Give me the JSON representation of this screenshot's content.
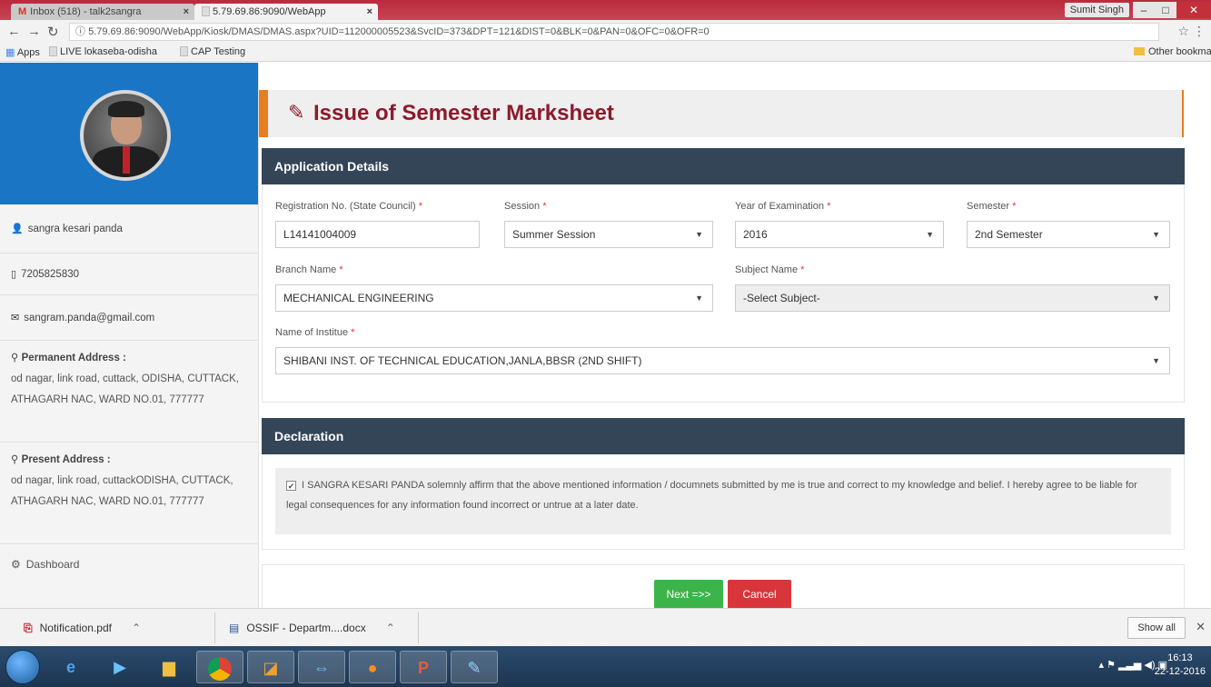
{
  "browser": {
    "tabs": [
      {
        "label": "Inbox (518) - talk2sangra",
        "icon": "gmail-icon"
      },
      {
        "label": "5.79.69.86:9090/WebApp",
        "icon": "page-icon"
      }
    ],
    "user": "Sumit Singh",
    "url": "5.79.69.86:9090/WebApp/Kiosk/DMAS/DMAS.aspx?UID=112000005523&SvcID=373&DPT=121&DIST=0&BLK=0&PAN=0&OFC=0&OFR=0",
    "bookmarks": [
      "Apps",
      "LIVE lokaseba-odisha",
      "CAP Testing"
    ],
    "other_bookmarks": "Other bookmarks"
  },
  "sidebar": {
    "name": "sangra kesari panda",
    "phone": "7205825830",
    "email": "sangram.panda@gmail.com",
    "permanent_title": "Permanent Address :",
    "permanent_address": "od nagar, link road, cuttack, ODISHA, CUTTACK, ATHAGARH NAC, WARD NO.01, 777777",
    "present_title": "Present Address :",
    "present_address": "od nagar, link road, cuttackODISHA, CUTTACK, ATHAGARH NAC, WARD NO.01, 777777",
    "dashboard": "Dashboard"
  },
  "main": {
    "page_title": "Issue of Semester Marksheet",
    "app_details_title": "Application Details",
    "fields": {
      "reg_label": "Registration No. (State Council)",
      "reg_value": "L14141004009",
      "session_label": "Session",
      "session_value": "Summer Session",
      "year_label": "Year of Examination",
      "year_value": "2016",
      "semester_label": "Semester",
      "semester_value": "2nd Semester",
      "branch_label": "Branch Name",
      "branch_value": "MECHANICAL ENGINEERING",
      "subject_label": "Subject Name",
      "subject_value": "-Select Subject-",
      "institute_label": "Name of Institue",
      "institute_value": "SHIBANI INST. OF TECHNICAL EDUCATION,JANLA,BBSR (2ND SHIFT)"
    },
    "declaration_title": "Declaration",
    "declaration_text": "I SANGRA KESARI PANDA solemnly affirm that the above mentioned information / documnets submitted by me is true and correct to my knowledge and belief. I hereby agree to be liable for legal consequences for any information found incorrect or untrue at a later date.",
    "next_label": "Next =>>",
    "cancel_label": "Cancel"
  },
  "downloads": {
    "items": [
      "Notification.pdf",
      "OSSIF - Departm....docx"
    ],
    "show_all": "Show all"
  },
  "taskbar": {
    "time": "16:13",
    "date": "22-12-2016"
  }
}
